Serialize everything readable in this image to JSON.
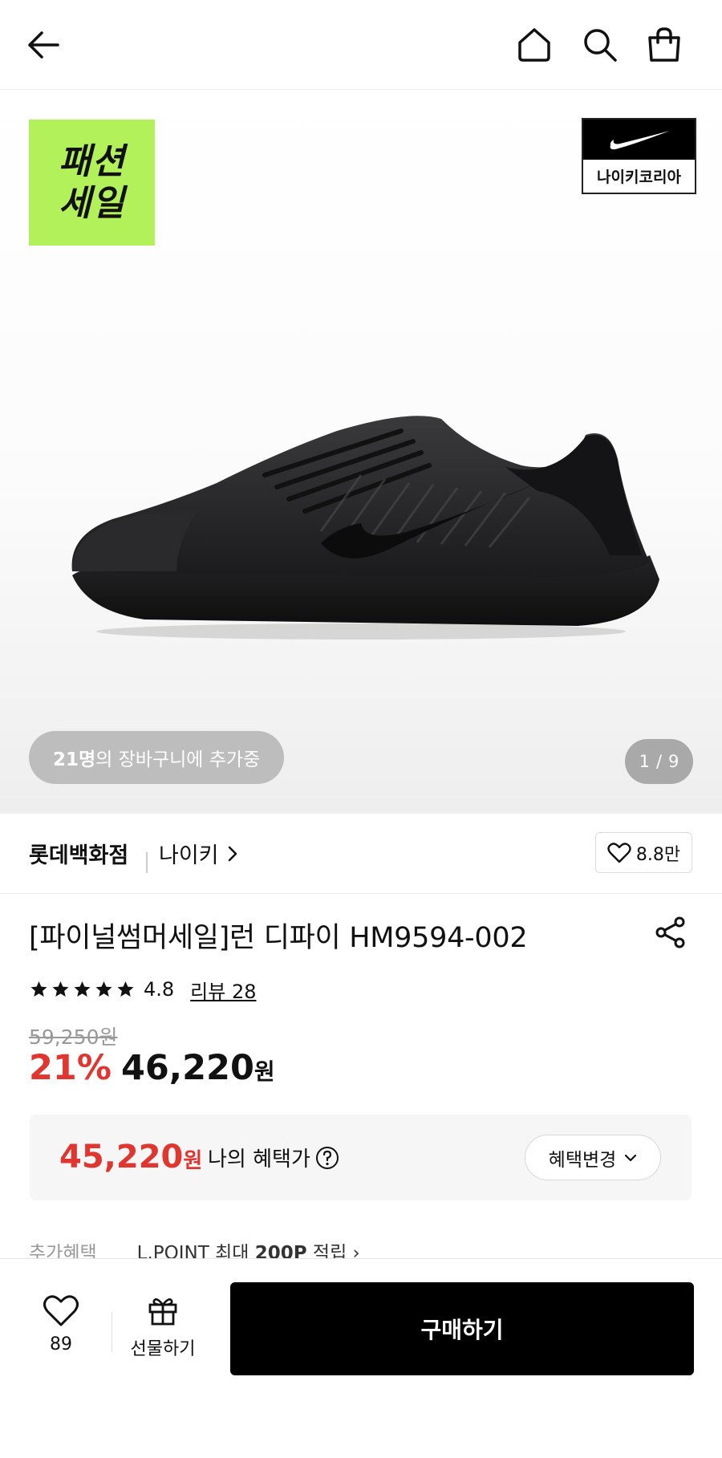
{
  "header": {
    "back_icon": "arrow-left-icon",
    "home_icon": "home-icon",
    "search_icon": "search-icon",
    "cart_icon": "shopping-bag-icon"
  },
  "hero": {
    "sale_badge_line1": "패션",
    "sale_badge_line2": "세일",
    "sale_badge_color": "#b3f15a",
    "brand_logo_text": "나이키코리아",
    "cart_count_bold": "21명",
    "cart_count_rest": "의 장바구니에 추가중",
    "image_index": "1",
    "image_total": "9"
  },
  "store": {
    "name": "롯데백화점",
    "brand": "나이키",
    "likes": "8.8만"
  },
  "product": {
    "title": "[파이널썸머세일]런 디파이 HM9594-002",
    "rating_value": 4.8,
    "rating_text": "4.8",
    "star_count": 5,
    "review_label": "리뷰 28",
    "original_price": "59,250원",
    "discount_rate": "21%",
    "price": "46,220",
    "price_unit": "원"
  },
  "benefit": {
    "price": "45,220",
    "unit": "원",
    "label": "나의 혜택가",
    "change_button": "혜택변경"
  },
  "extra": {
    "label": "추가혜택",
    "text_prefix": "L.POINT 최대 ",
    "text_bold": "200P",
    "text_suffix": " 적립"
  },
  "bottom_bar": {
    "wish_count": "89",
    "gift_label": "선물하기",
    "buy_label": "구매하기"
  },
  "colors": {
    "accent_red": "#e0362f",
    "buy_button": "#000000"
  }
}
